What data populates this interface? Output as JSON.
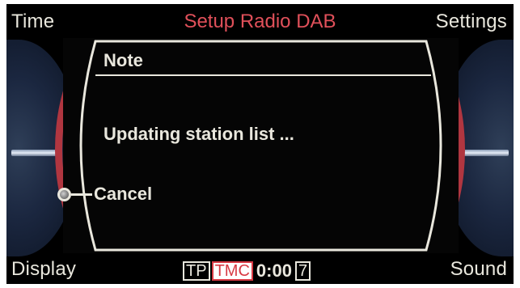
{
  "header": {
    "left_softkey": "Time",
    "title": "Setup Radio DAB",
    "right_softkey": "Settings"
  },
  "dialog": {
    "title": "Note",
    "message": "Updating station list ...",
    "cancel_label": "Cancel"
  },
  "footer": {
    "left_softkey": "Display",
    "right_softkey": "Sound",
    "status": {
      "tp": "TP",
      "tmc": "TMC",
      "clock": "0:00",
      "channel": "7"
    }
  },
  "colors": {
    "accent_red": "#e0505a",
    "text": "#e9e7dd",
    "background": "#000000"
  }
}
